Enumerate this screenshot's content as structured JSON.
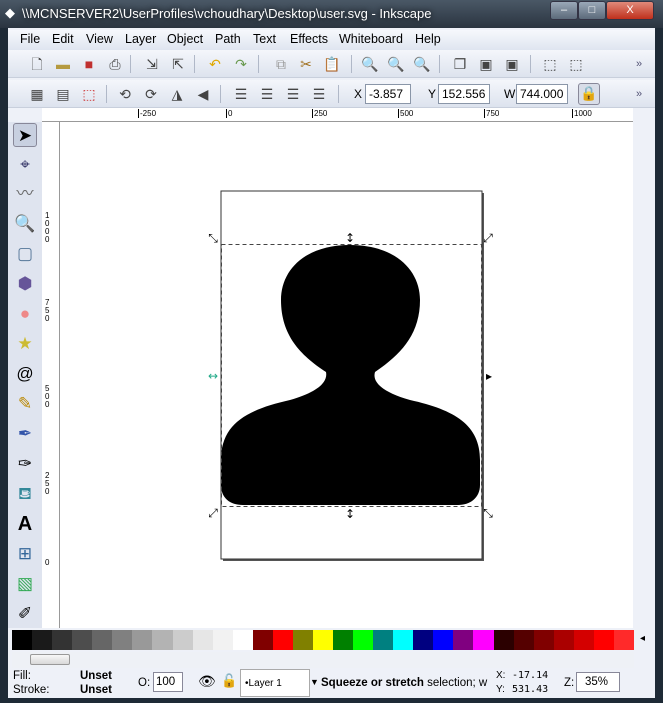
{
  "window": {
    "title": "\\\\MCNSERVER2\\UserProfiles\\vchoudhary\\Desktop\\user.svg - Inkscape",
    "minimize": "–",
    "maximize": "□",
    "close": "X"
  },
  "menu": [
    "File",
    "Edit",
    "View",
    "Layer",
    "Object",
    "Path",
    "Text",
    "Effects",
    "Whiteboard",
    "Help"
  ],
  "toolbar2": {
    "x_label": "X",
    "x_value": "-3.857",
    "y_label": "Y",
    "y_value": "152.556",
    "w_label": "W",
    "w_value": "744.000",
    "more": "»"
  },
  "toolbar1": {
    "more": "»"
  },
  "hruler": [
    "-250",
    "0",
    "250",
    "500",
    "750",
    "1000"
  ],
  "vruler": [
    "1000",
    "750",
    "500",
    "250",
    "0"
  ],
  "palette": [
    "#000000",
    "#1a1a1a",
    "#333333",
    "#4d4d4d",
    "#666666",
    "#808080",
    "#999999",
    "#b3b3b3",
    "#cccccc",
    "#e6e6e6",
    "#f2f2f2",
    "#ffffff",
    "#800000",
    "#ff0000",
    "#808000",
    "#ffff00",
    "#008000",
    "#00ff00",
    "#008080",
    "#00ffff",
    "#000080",
    "#0000ff",
    "#800080",
    "#ff00ff",
    "#2b0000",
    "#550000",
    "#800000",
    "#aa0000",
    "#d40000",
    "#ff0000",
    "#ff2a2a"
  ],
  "status": {
    "fill_label": "Fill:",
    "fill_value": "Unset",
    "stroke_label": "Stroke:",
    "stroke_value": "Unset",
    "opacity_label": "O:",
    "opacity_value": "100",
    "layer": "•Layer 1",
    "message_bold": "Squeeze or stretch",
    "message_rest": " selection; w",
    "x_label": "X:",
    "x_value": "-17.14",
    "y_label": "Y:",
    "y_value": "531.43",
    "zoom_label": "Z:",
    "zoom_value": "35%"
  }
}
